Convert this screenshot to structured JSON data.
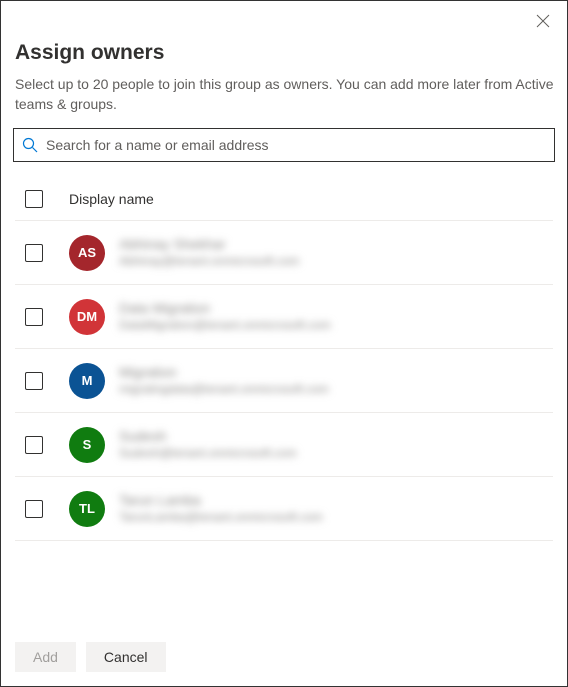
{
  "title": "Assign owners",
  "subtitle": "Select up to 20 people to join this group as owners. You can add more later from Active teams & groups.",
  "search": {
    "placeholder": "Search for a name or email address"
  },
  "table": {
    "header": "Display name",
    "rows": [
      {
        "initials": "AS",
        "color": "#a4262c",
        "name": "Abhinay Shekhar",
        "email": "Abhinay@tenant.onmicrosoft.com"
      },
      {
        "initials": "DM",
        "color": "#d13438",
        "name": "Data Migration",
        "email": "DataMigration@tenant.onmicrosoft.com"
      },
      {
        "initials": "M",
        "color": "#0b5394",
        "name": "Migration",
        "email": "migratingdata@tenant.onmicrosoft.com"
      },
      {
        "initials": "S",
        "color": "#107c10",
        "name": "Sudesh",
        "email": "Sudesh@tenant.onmicrosoft.com"
      },
      {
        "initials": "TL",
        "color": "#107c10",
        "name": "Tarun Lamba",
        "email": "TarunLamba@tenant.onmicrosoft.com"
      }
    ]
  },
  "buttons": {
    "add": "Add",
    "cancel": "Cancel"
  }
}
